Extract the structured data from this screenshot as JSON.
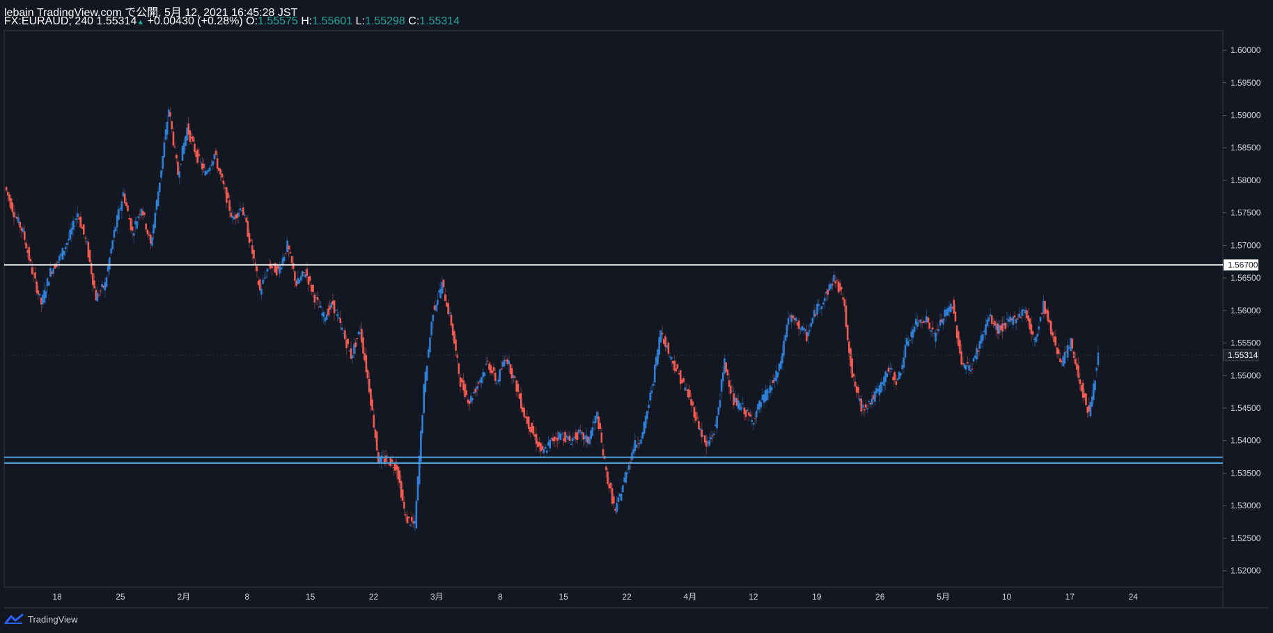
{
  "header": {
    "publish_line": "lebain TradingView.com で公開, 5月 12, 2021 16:45:28 JST",
    "symbol": "FX:EURAUD, 240",
    "last": "1.55314",
    "change": "+0.00430 (+0.28%)",
    "o_label": "O:",
    "o_value": "1.55575",
    "h_label": "H:",
    "h_value": "1.55601",
    "l_label": "L:",
    "l_value": "1.55298",
    "c_label": "C:",
    "c_value": "1.55314"
  },
  "footer": {
    "brand": "TradingView",
    "logo_icon": "tradingview-logo-icon"
  },
  "colors": {
    "background": "#131722",
    "bull": "#2f7fd6",
    "bear": "#f05a50",
    "grid_text": "#d1d4dc",
    "border": "#363a45",
    "resistance_line": "#ffffff",
    "support_line": "#4aa3e0",
    "last_price_label": "#ffffff"
  },
  "chart_data": {
    "type": "candlestick",
    "series": [
      {
        "name": "",
        "timeframe": "240"
      }
    ],
    "x_tick_labels": [
      "18",
      "25",
      "2月",
      "8",
      "15",
      "22",
      "3月",
      "8",
      "15",
      "22",
      "4月",
      "12",
      "19",
      "26",
      "5月",
      "10",
      "17",
      "24"
    ],
    "y_tick_labels": [
      "1.60000",
      "1.59500",
      "1.59000",
      "1.58500",
      "1.58000",
      "1.57500",
      "1.57000",
      "1.56500",
      "1.56000",
      "1.55500",
      "1.55000",
      "1.54500",
      "1.54000",
      "1.53500",
      "1.53000",
      "1.52500",
      "1.52000"
    ],
    "ylim": [
      1.5175,
      1.603
    ],
    "horizontal_lines": [
      {
        "price": 1.567,
        "label": "1.56700",
        "color": "#ffffff"
      },
      {
        "price": 1.53745,
        "label": "",
        "color": "#4aa3e0"
      },
      {
        "price": 1.53655,
        "label": "",
        "color": "#4aa3e0"
      }
    ],
    "last_price": {
      "price": 1.55314,
      "label": "1.55314"
    },
    "path_points": [
      {
        "x": "Jan 12",
        "y": 1.579
      },
      {
        "x": "Jan 13",
        "y": 1.575
      },
      {
        "x": "Jan 14",
        "y": 1.572
      },
      {
        "x": "Jan 15",
        "y": 1.566
      },
      {
        "x": "Jan 16",
        "y": 1.561
      },
      {
        "x": "Jan 17",
        "y": 1.566
      },
      {
        "x": "Jan 18",
        "y": 1.568
      },
      {
        "x": "Jan 19",
        "y": 1.571
      },
      {
        "x": "Jan 20",
        "y": 1.575
      },
      {
        "x": "Jan 21",
        "y": 1.57
      },
      {
        "x": "Jan 22",
        "y": 1.562
      },
      {
        "x": "Jan 23",
        "y": 1.564
      },
      {
        "x": "Jan 24",
        "y": 1.572
      },
      {
        "x": "Jan 25",
        "y": 1.578
      },
      {
        "x": "Jan 26",
        "y": 1.572
      },
      {
        "x": "Jan 27",
        "y": 1.576
      },
      {
        "x": "Jan 28",
        "y": 1.57
      },
      {
        "x": "Jan 29",
        "y": 1.58
      },
      {
        "x": "Jan 30",
        "y": 1.591
      },
      {
        "x": "Jan 31",
        "y": 1.581
      },
      {
        "x": "Feb 1",
        "y": 1.588
      },
      {
        "x": "Feb 2",
        "y": 1.584
      },
      {
        "x": "Feb 3",
        "y": 1.581
      },
      {
        "x": "Feb 4",
        "y": 1.584
      },
      {
        "x": "Feb 5",
        "y": 1.579
      },
      {
        "x": "Feb 6",
        "y": 1.574
      },
      {
        "x": "Feb 7",
        "y": 1.576
      },
      {
        "x": "Feb 8",
        "y": 1.57
      },
      {
        "x": "Feb 9",
        "y": 1.563
      },
      {
        "x": "Feb 10",
        "y": 1.567
      },
      {
        "x": "Feb 11",
        "y": 1.566
      },
      {
        "x": "Feb 12",
        "y": 1.57
      },
      {
        "x": "Feb 13",
        "y": 1.564
      },
      {
        "x": "Feb 14",
        "y": 1.566
      },
      {
        "x": "Feb 15",
        "y": 1.562
      },
      {
        "x": "Feb 16",
        "y": 1.559
      },
      {
        "x": "Feb 17",
        "y": 1.561
      },
      {
        "x": "Feb 18",
        "y": 1.557
      },
      {
        "x": "Feb 19",
        "y": 1.553
      },
      {
        "x": "Feb 20",
        "y": 1.557
      },
      {
        "x": "Feb 21",
        "y": 1.548
      },
      {
        "x": "Feb 22",
        "y": 1.537
      },
      {
        "x": "Feb 23",
        "y": 1.537
      },
      {
        "x": "Feb 24",
        "y": 1.536
      },
      {
        "x": "Feb 25",
        "y": 1.528
      },
      {
        "x": "Feb 26",
        "y": 1.527
      },
      {
        "x": "Feb 27",
        "y": 1.548
      },
      {
        "x": "Feb 28",
        "y": 1.56
      },
      {
        "x": "Mar 1",
        "y": 1.564
      },
      {
        "x": "Mar 2",
        "y": 1.558
      },
      {
        "x": "Mar 3",
        "y": 1.549
      },
      {
        "x": "Mar 4",
        "y": 1.546
      },
      {
        "x": "Mar 5",
        "y": 1.549
      },
      {
        "x": "Mar 6",
        "y": 1.552
      },
      {
        "x": "Mar 7",
        "y": 1.549
      },
      {
        "x": "Mar 8",
        "y": 1.553
      },
      {
        "x": "Mar 9",
        "y": 1.549
      },
      {
        "x": "Mar 10",
        "y": 1.544
      },
      {
        "x": "Mar 11",
        "y": 1.541
      },
      {
        "x": "Mar 12",
        "y": 1.538
      },
      {
        "x": "Mar 13",
        "y": 1.54
      },
      {
        "x": "Mar 14",
        "y": 1.541
      },
      {
        "x": "Mar 15",
        "y": 1.54
      },
      {
        "x": "Mar 16",
        "y": 1.541
      },
      {
        "x": "Mar 17",
        "y": 1.54
      },
      {
        "x": "Mar 18",
        "y": 1.544
      },
      {
        "x": "Mar 19",
        "y": 1.535
      },
      {
        "x": "Mar 20",
        "y": 1.529
      },
      {
        "x": "Mar 21",
        "y": 1.534
      },
      {
        "x": "Mar 22",
        "y": 1.539
      },
      {
        "x": "Mar 23",
        "y": 1.541
      },
      {
        "x": "Mar 24",
        "y": 1.548
      },
      {
        "x": "Mar 25",
        "y": 1.557
      },
      {
        "x": "Mar 26",
        "y": 1.553
      },
      {
        "x": "Mar 27",
        "y": 1.55
      },
      {
        "x": "Mar 28",
        "y": 1.547
      },
      {
        "x": "Mar 29",
        "y": 1.543
      },
      {
        "x": "Mar 30",
        "y": 1.539
      },
      {
        "x": "Mar 31",
        "y": 1.542
      },
      {
        "x": "Apr 1",
        "y": 1.552
      },
      {
        "x": "Apr 2",
        "y": 1.546
      },
      {
        "x": "Apr 3",
        "y": 1.545
      },
      {
        "x": "Apr 4",
        "y": 1.543
      },
      {
        "x": "Apr 5",
        "y": 1.546
      },
      {
        "x": "Apr 6",
        "y": 1.548
      },
      {
        "x": "Apr 7",
        "y": 1.551
      },
      {
        "x": "Apr 8",
        "y": 1.559
      },
      {
        "x": "Apr 9",
        "y": 1.558
      },
      {
        "x": "Apr 10",
        "y": 1.556
      },
      {
        "x": "Apr 11",
        "y": 1.56
      },
      {
        "x": "Apr 12",
        "y": 1.562
      },
      {
        "x": "Apr 13",
        "y": 1.565
      },
      {
        "x": "Apr 14",
        "y": 1.562
      },
      {
        "x": "Apr 15",
        "y": 1.55
      },
      {
        "x": "Apr 16",
        "y": 1.545
      },
      {
        "x": "Apr 17",
        "y": 1.546
      },
      {
        "x": "Apr 18",
        "y": 1.548
      },
      {
        "x": "Apr 19",
        "y": 1.551
      },
      {
        "x": "Apr 20",
        "y": 1.549
      },
      {
        "x": "Apr 21",
        "y": 1.555
      },
      {
        "x": "Apr 22",
        "y": 1.558
      },
      {
        "x": "Apr 23",
        "y": 1.559
      },
      {
        "x": "Apr 24",
        "y": 1.556
      },
      {
        "x": "Apr 25",
        "y": 1.559
      },
      {
        "x": "Apr 26",
        "y": 1.561
      },
      {
        "x": "Apr 27",
        "y": 1.552
      },
      {
        "x": "Apr 28",
        "y": 1.551
      },
      {
        "x": "Apr 29",
        "y": 1.555
      },
      {
        "x": "Apr 30",
        "y": 1.559
      },
      {
        "x": "May 1",
        "y": 1.557
      },
      {
        "x": "May 2",
        "y": 1.558
      },
      {
        "x": "May 3",
        "y": 1.559
      },
      {
        "x": "May 4",
        "y": 1.56
      },
      {
        "x": "May 5",
        "y": 1.555
      },
      {
        "x": "May 6",
        "y": 1.561
      },
      {
        "x": "May 7",
        "y": 1.556
      },
      {
        "x": "May 8",
        "y": 1.552
      },
      {
        "x": "May 9",
        "y": 1.555
      },
      {
        "x": "May 10",
        "y": 1.549
      },
      {
        "x": "May 11",
        "y": 1.544
      },
      {
        "x": "May 12",
        "y": 1.553
      }
    ]
  }
}
